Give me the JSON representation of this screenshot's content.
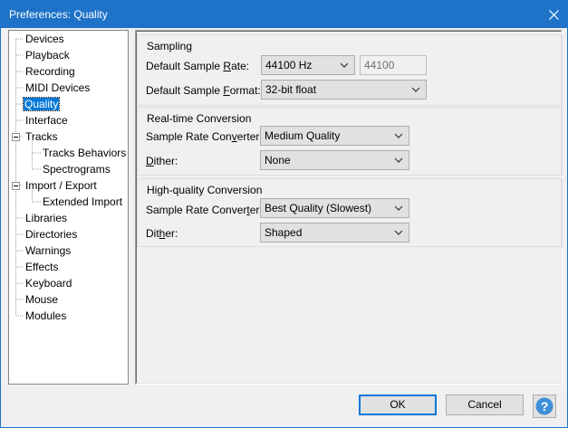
{
  "window": {
    "title": "Preferences: Quality"
  },
  "tree": {
    "items": [
      {
        "label": "Devices"
      },
      {
        "label": "Playback"
      },
      {
        "label": "Recording"
      },
      {
        "label": "MIDI Devices"
      },
      {
        "label": "Quality",
        "selected": true
      },
      {
        "label": "Interface"
      },
      {
        "label": "Tracks",
        "expanded": true
      },
      {
        "label": "Tracks Behaviors"
      },
      {
        "label": "Spectrograms"
      },
      {
        "label": "Import / Export",
        "expanded": true
      },
      {
        "label": "Extended Import"
      },
      {
        "label": "Libraries"
      },
      {
        "label": "Directories"
      },
      {
        "label": "Warnings"
      },
      {
        "label": "Effects"
      },
      {
        "label": "Keyboard"
      },
      {
        "label": "Mouse"
      },
      {
        "label": "Modules"
      }
    ]
  },
  "sampling": {
    "title": "Sampling",
    "rate_label_pre": "Default Sample ",
    "rate_label_key": "R",
    "rate_label_post": "ate:",
    "rate_value": "44100 Hz",
    "rate_custom": "44100",
    "format_label_pre": "Default Sample ",
    "format_label_key": "F",
    "format_label_post": "ormat:",
    "format_value": "32-bit float"
  },
  "realtime": {
    "title": "Real-time Conversion",
    "converter_label_pre": "Sample Rate Con",
    "converter_label_key": "v",
    "converter_label_post": "erter:",
    "converter_value": "Medium Quality",
    "dither_label_pre": "",
    "dither_label_key": "D",
    "dither_label_post": "ither:",
    "dither_value": "None"
  },
  "highquality": {
    "title": "High-quality Conversion",
    "converter_label_pre": "Sample Rate Conver",
    "converter_label_key": "t",
    "converter_label_post": "er:",
    "converter_value": "Best Quality (Slowest)",
    "dither_label_pre": "Dit",
    "dither_label_key": "h",
    "dither_label_post": "er:",
    "dither_value": "Shaped"
  },
  "buttons": {
    "ok": "OK",
    "cancel": "Cancel",
    "help": "?"
  },
  "colors": {
    "titlebar": "#1e73c8",
    "selection": "#0078d7",
    "help_icon": "#3f8fd8"
  }
}
